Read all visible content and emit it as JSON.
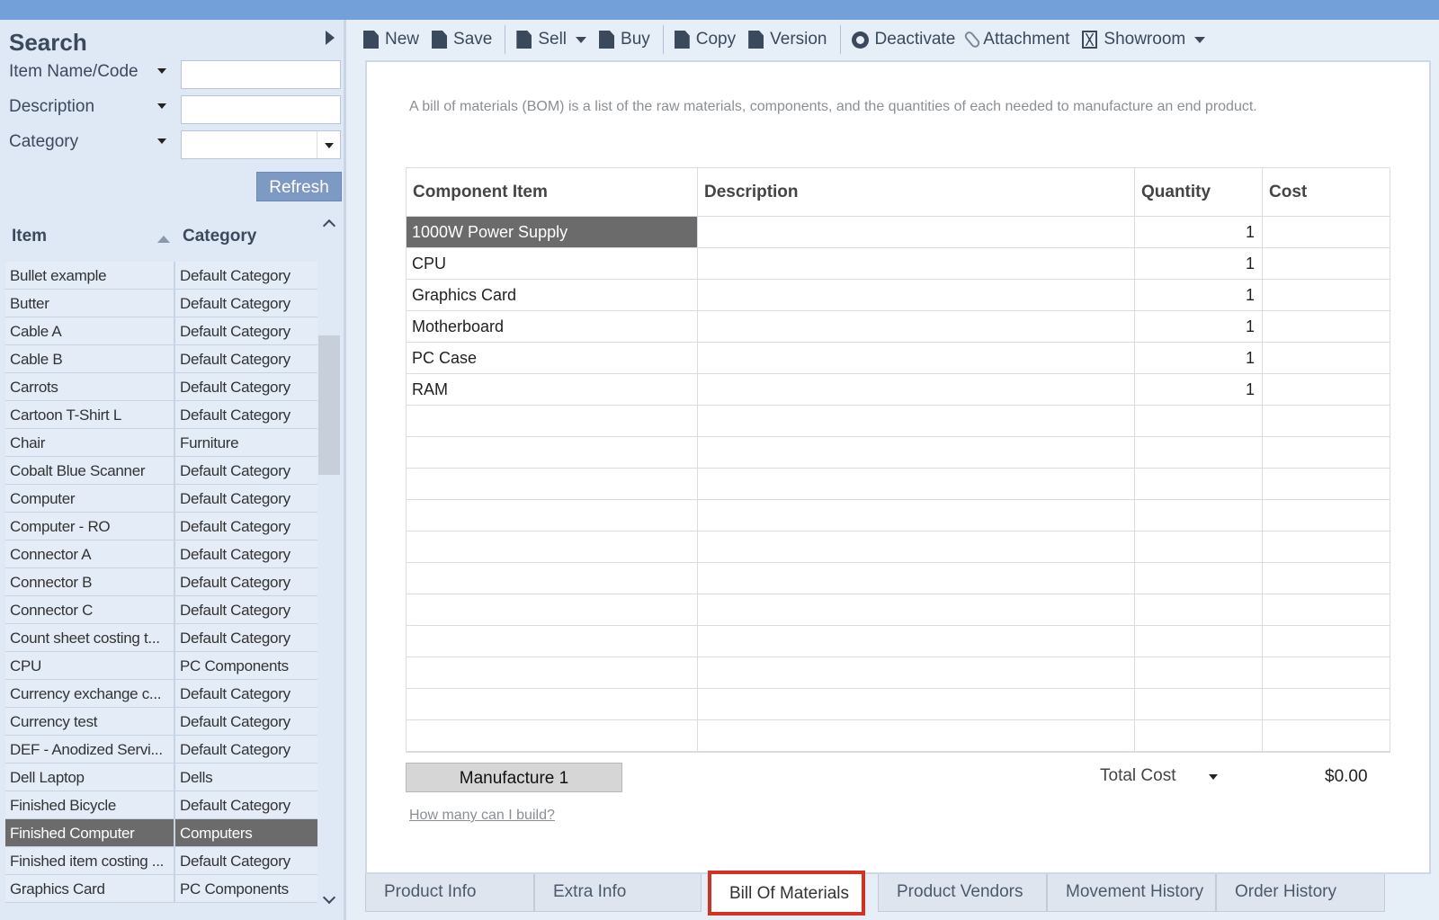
{
  "search": {
    "title": "Search",
    "fields": [
      {
        "label": "Item Name/Code",
        "value": ""
      },
      {
        "label": "Description",
        "value": ""
      },
      {
        "label": "Category",
        "value": ""
      }
    ],
    "refresh_label": "Refresh"
  },
  "item_grid": {
    "headers": {
      "item": "Item",
      "category": "Category"
    },
    "rows": [
      {
        "item": "Bullet example",
        "category": "Default Category"
      },
      {
        "item": "Butter",
        "category": "Default Category"
      },
      {
        "item": "Cable A",
        "category": "Default Category"
      },
      {
        "item": "Cable B",
        "category": "Default Category"
      },
      {
        "item": "Carrots",
        "category": "Default Category"
      },
      {
        "item": "Cartoon T-Shirt L",
        "category": "Default Category"
      },
      {
        "item": "Chair",
        "category": "Furniture"
      },
      {
        "item": "Cobalt Blue Scanner",
        "category": "Default Category"
      },
      {
        "item": "Computer",
        "category": "Default Category"
      },
      {
        "item": "Computer - RO",
        "category": "Default Category"
      },
      {
        "item": "Connector A",
        "category": "Default Category"
      },
      {
        "item": "Connector B",
        "category": "Default Category"
      },
      {
        "item": "Connector C",
        "category": "Default Category"
      },
      {
        "item": "Count sheet costing t...",
        "category": "Default Category"
      },
      {
        "item": "CPU",
        "category": "PC Components"
      },
      {
        "item": "Currency exchange c...",
        "category": "Default Category"
      },
      {
        "item": "Currency test",
        "category": "Default Category"
      },
      {
        "item": "DEF - Anodized Servi...",
        "category": "Default Category"
      },
      {
        "item": "Dell Laptop",
        "category": "Dells"
      },
      {
        "item": "Finished Bicycle",
        "category": "Default Category"
      },
      {
        "item": "Finished Computer",
        "category": "Computers"
      },
      {
        "item": "Finished item costing ...",
        "category": "Default Category"
      },
      {
        "item": "Graphics Card",
        "category": "PC Components"
      }
    ],
    "selected_index": 20
  },
  "toolbar": {
    "new": "New",
    "save": "Save",
    "sell": "Sell",
    "buy": "Buy",
    "copy": "Copy",
    "version": "Version",
    "deactivate": "Deactivate",
    "attachment": "Attachment",
    "showroom": "Showroom"
  },
  "bom": {
    "description": "A bill of materials (BOM) is a list of the raw materials, components, and the quantities of each needed to manufacture an end product.",
    "headers": {
      "component": "Component Item",
      "description": "Description",
      "quantity": "Quantity",
      "cost": "Cost"
    },
    "rows": [
      {
        "component": "1000W Power Supply",
        "description": "",
        "quantity": "1",
        "cost": ""
      },
      {
        "component": "CPU",
        "description": "",
        "quantity": "1",
        "cost": ""
      },
      {
        "component": "Graphics Card",
        "description": "",
        "quantity": "1",
        "cost": ""
      },
      {
        "component": "Motherboard",
        "description": "",
        "quantity": "1",
        "cost": ""
      },
      {
        "component": "PC Case",
        "description": "",
        "quantity": "1",
        "cost": ""
      },
      {
        "component": "RAM",
        "description": "",
        "quantity": "1",
        "cost": ""
      }
    ],
    "selected_index": 0,
    "empty_rows": 11,
    "manufacture_label": "Manufacture 1",
    "total_cost_label": "Total Cost",
    "total_cost_value": "$0.00",
    "build_link": "How many can I build?"
  },
  "tabs": [
    {
      "label": "Product Info",
      "active": false
    },
    {
      "label": "Extra Info",
      "active": false
    },
    {
      "label": "Bill Of Materials",
      "active": true
    },
    {
      "label": "Product Vendors",
      "active": false
    },
    {
      "label": "Movement History",
      "active": false
    },
    {
      "label": "Order History",
      "active": false
    }
  ],
  "colors": {
    "titlebar": "#73a0d8",
    "selection": "#6b6b6b",
    "active_tab_border": "#d63120",
    "refresh_button": "#7d9ac4"
  }
}
